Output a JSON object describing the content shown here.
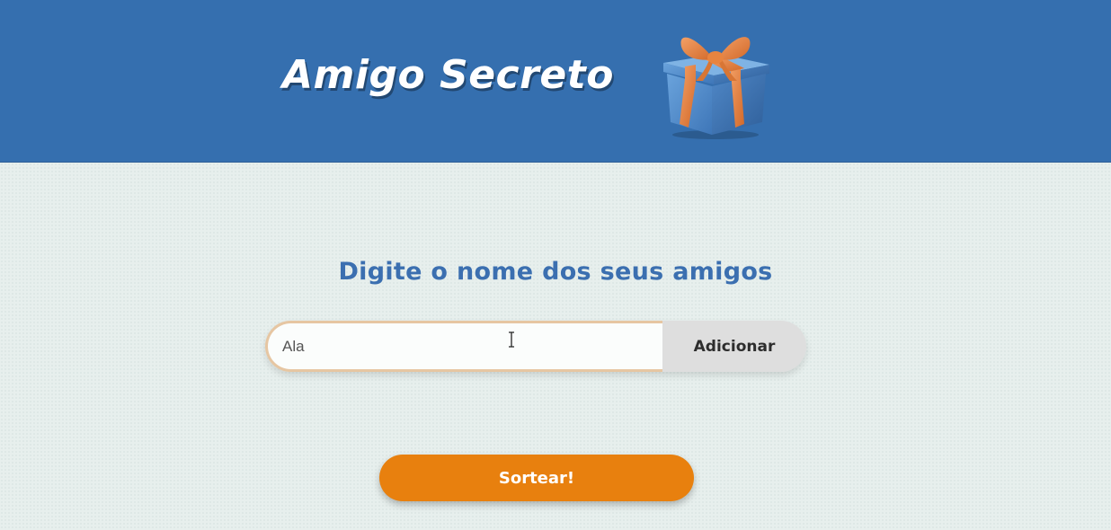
{
  "header": {
    "title": "Amigo Secreto",
    "image_icon": "gift-box-icon"
  },
  "main": {
    "heading": "Digite o nome dos seus amigos",
    "name_input": {
      "value": "Ala"
    },
    "add_button_label": "Adicionar",
    "draw_button_label": "Sortear!",
    "cursor_icon": "text-cursor-icon"
  },
  "colors": {
    "header_bg": "#356faf",
    "page_bg": "#e8f0ee",
    "heading": "#3b6fb0",
    "input_border": "#e6c6a2",
    "add_button_bg": "#dedede",
    "draw_button_bg": "#e8800e"
  }
}
